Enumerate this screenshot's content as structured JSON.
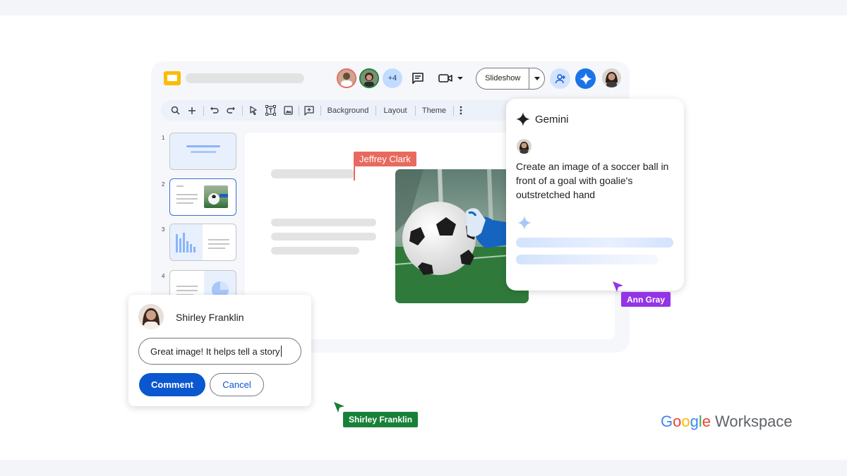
{
  "collaborators": {
    "extra_count": "+4"
  },
  "header": {
    "slideshow_label": "Slideshow"
  },
  "toolbar": {
    "background_label": "Background",
    "layout_label": "Layout",
    "theme_label": "Theme"
  },
  "thumbnails": [
    {
      "number": "1"
    },
    {
      "number": "2"
    },
    {
      "number": "3"
    },
    {
      "number": "4"
    }
  ],
  "cursors": {
    "jeffrey": {
      "name": "Jeffrey Clark",
      "color": "#e8695e"
    },
    "ann": {
      "name": "Ann Gray",
      "color": "#9334e6"
    },
    "shirley": {
      "name": "Shirley Franklin",
      "color": "#188038"
    }
  },
  "gemini": {
    "title": "Gemini",
    "prompt": "Create an image of a soccer ball in front of a goal with goalie's outstretched hand"
  },
  "comment": {
    "author": "Shirley Franklin",
    "input_value": "Great image! It helps tell a story",
    "comment_label": "Comment",
    "cancel_label": "Cancel"
  },
  "brand": {
    "google": "Google",
    "workspace": "Workspace"
  },
  "colors": {
    "accent_blue": "#0b57d0",
    "slides_yellow": "#fbbc04"
  }
}
